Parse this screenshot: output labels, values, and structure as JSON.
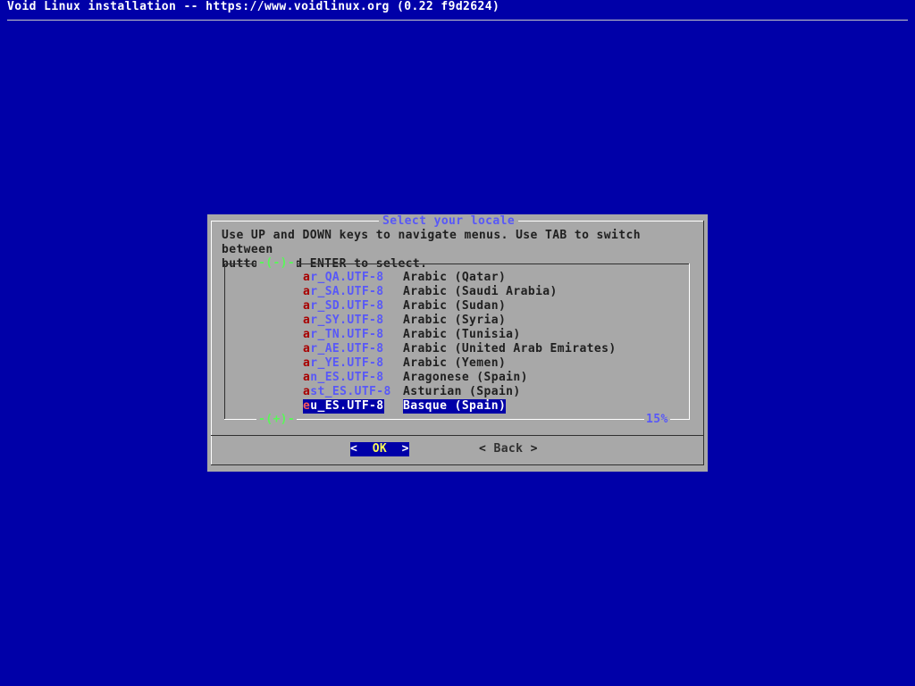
{
  "backtitle": "Void Linux installation -- https://www.voidlinux.org (0.22 f9d2624)",
  "dialog": {
    "title": "Select your locale",
    "instructions": "Use UP and DOWN keys to navigate menus. Use TAB to switch between\nbuttons and ENTER to select.",
    "scroll_up_indicator": "-(-)-",
    "scroll_down_indicator": "-(+)-",
    "scroll_percent": "15%",
    "items": [
      {
        "hot": "a",
        "rest": "r_QA.UTF-8",
        "desc": "Arabic (Qatar)"
      },
      {
        "hot": "a",
        "rest": "r_SA.UTF-8",
        "desc": "Arabic (Saudi Arabia)"
      },
      {
        "hot": "a",
        "rest": "r_SD.UTF-8",
        "desc": "Arabic (Sudan)"
      },
      {
        "hot": "a",
        "rest": "r_SY.UTF-8",
        "desc": "Arabic (Syria)"
      },
      {
        "hot": "a",
        "rest": "r_TN.UTF-8",
        "desc": "Arabic (Tunisia)"
      },
      {
        "hot": "a",
        "rest": "r_AE.UTF-8",
        "desc": "Arabic (United Arab Emirates)"
      },
      {
        "hot": "a",
        "rest": "r_YE.UTF-8",
        "desc": "Arabic (Yemen)"
      },
      {
        "hot": "a",
        "rest": "n_ES.UTF-8",
        "desc": "Aragonese (Spain)"
      },
      {
        "hot": "a",
        "rest": "st_ES.UTF-8",
        "desc": "Asturian (Spain)"
      },
      {
        "hot": "e",
        "rest": "u_ES.UTF-8",
        "desc": "Basque (Spain)",
        "selected": true
      }
    ],
    "buttons": {
      "ok": {
        "left": "<  ",
        "label": "OK",
        "right": "  >"
      },
      "back": {
        "left": "< ",
        "label": "Back",
        "right": " >"
      }
    }
  },
  "colors": {
    "background": "#0000a8",
    "dialog": "#a8a8a8",
    "tag_text": "#5858f8",
    "hotkey": "#a80000",
    "scroll_indicator": "#58f858"
  }
}
